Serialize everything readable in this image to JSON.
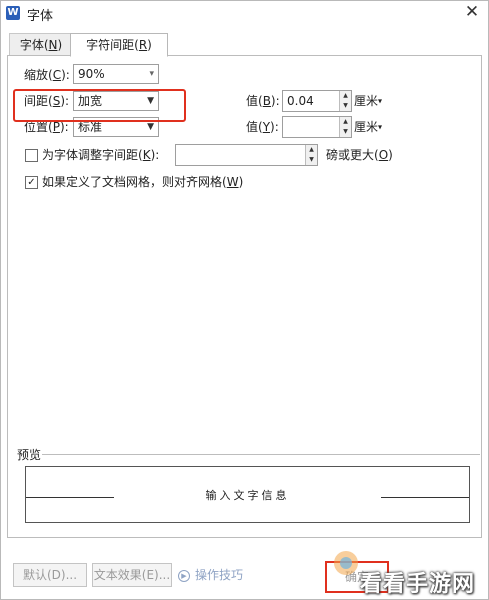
{
  "window": {
    "title": "字体",
    "app_icon_letter": "W",
    "close_glyph": "✕"
  },
  "tabs": [
    {
      "label": "字体(",
      "key": "N",
      "suffix": ")"
    },
    {
      "label": "字符间距(",
      "key": "R",
      "suffix": ")"
    }
  ],
  "scale": {
    "label": "缩放(",
    "key": "C",
    "suffix": "):",
    "value": "90%"
  },
  "spacing": {
    "label": "间距(",
    "key": "S",
    "suffix": "):",
    "value": "加宽"
  },
  "position": {
    "label": "位置(",
    "key": "P",
    "suffix": "):",
    "value": "标准"
  },
  "spacing_amount": {
    "label": "值(",
    "key": "B",
    "suffix": "):",
    "value": "0.04",
    "unit": "厘米"
  },
  "position_amount": {
    "label": "值(",
    "key": "Y",
    "suffix": "):",
    "value": "",
    "unit": "厘米"
  },
  "kerning": {
    "label": "为字体调整字间距(",
    "key": "K",
    "suffix": "):",
    "value": "",
    "after": "磅或更大(",
    "after_key": "O",
    "after_suffix": ")",
    "checked": false
  },
  "grid": {
    "label": "如果定义了文档网格，则对齐网格(",
    "key": "W",
    "suffix": ")",
    "checked": true
  },
  "preview": {
    "label": "预览",
    "text": "输入文字信息"
  },
  "buttons": {
    "default": "默认(D)...",
    "text_effects": "文本效果(E)...",
    "tips": "操作技巧",
    "ok": "确定"
  },
  "watermark": "看看手游网",
  "colors": {
    "highlight": "#e0301e",
    "app_icon": "#2b5fb8"
  }
}
